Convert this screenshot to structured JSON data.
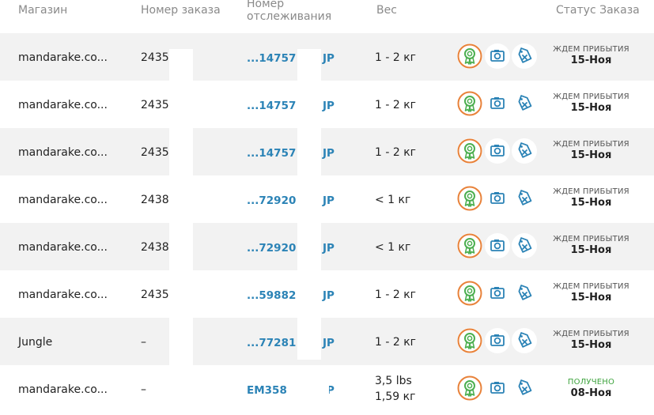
{
  "header": {
    "shop": "Магазин",
    "order": "Номер заказа",
    "tracking_line1": "Номер",
    "tracking_line2": "отслеживания",
    "weight": "Вес",
    "status": "Статус Заказа"
  },
  "colors": {
    "link": "#2b83b6",
    "received": "#3da33d",
    "row_alt": "#f2f2f2",
    "badge_ring": "#e8823a",
    "badge_green": "#4caf50",
    "icon_blue": "#2b83b6"
  },
  "icons": {
    "badge": "award-badge-icon",
    "photo": "camera-icon",
    "tag": "tag-cancel-icon"
  },
  "rows": [
    {
      "shop": "mandarake.co...",
      "order": "2435",
      "tracking": "...14757",
      "tracking_suffix": "JP",
      "weight": "1 - 2 кг",
      "weight2": "",
      "status": "ЖДЕМ ПРИБЫТИЯ",
      "date": "15-Ноя",
      "received": false
    },
    {
      "shop": "mandarake.co...",
      "order": "2435",
      "tracking": "...14757",
      "tracking_suffix": "JP",
      "weight": "1 - 2 кг",
      "weight2": "",
      "status": "ЖДЕМ ПРИБЫТИЯ",
      "date": "15-Ноя",
      "received": false
    },
    {
      "shop": "mandarake.co...",
      "order": "2435",
      "tracking": "...14757",
      "tracking_suffix": "JP",
      "weight": "1 - 2 кг",
      "weight2": "",
      "status": "ЖДЕМ ПРИБЫТИЯ",
      "date": "15-Ноя",
      "received": false
    },
    {
      "shop": "mandarake.co...",
      "order": "2438",
      "tracking": "...72920",
      "tracking_suffix": "JP",
      "weight": "< 1 кг",
      "weight2": "",
      "status": "ЖДЕМ ПРИБЫТИЯ",
      "date": "15-Ноя",
      "received": false
    },
    {
      "shop": "mandarake.co...",
      "order": "2438",
      "tracking": "...72920",
      "tracking_suffix": "JP",
      "weight": "< 1 кг",
      "weight2": "",
      "status": "ЖДЕМ ПРИБЫТИЯ",
      "date": "15-Ноя",
      "received": false
    },
    {
      "shop": "mandarake.co...",
      "order": "2435",
      "tracking": "...59882",
      "tracking_suffix": "JP",
      "weight": "1 - 2 кг",
      "weight2": "",
      "status": "ЖДЕМ ПРИБЫТИЯ",
      "date": "15-Ноя",
      "received": false
    },
    {
      "shop": "Jungle",
      "order": "–",
      "tracking": "...77281",
      "tracking_suffix": "JP",
      "weight": "1 - 2 кг",
      "weight2": "",
      "status": "ЖДЕМ ПРИБЫТИЯ",
      "date": "15-Ноя",
      "received": false
    },
    {
      "shop": "mandarake.co...",
      "order": "–",
      "tracking": "EM358",
      "tracking_suffix": "JP",
      "weight": "3,5 lbs",
      "weight2": "1,59 кг",
      "status": "ПОЛУЧЕНО",
      "date": "08-Ноя",
      "received": true
    }
  ]
}
